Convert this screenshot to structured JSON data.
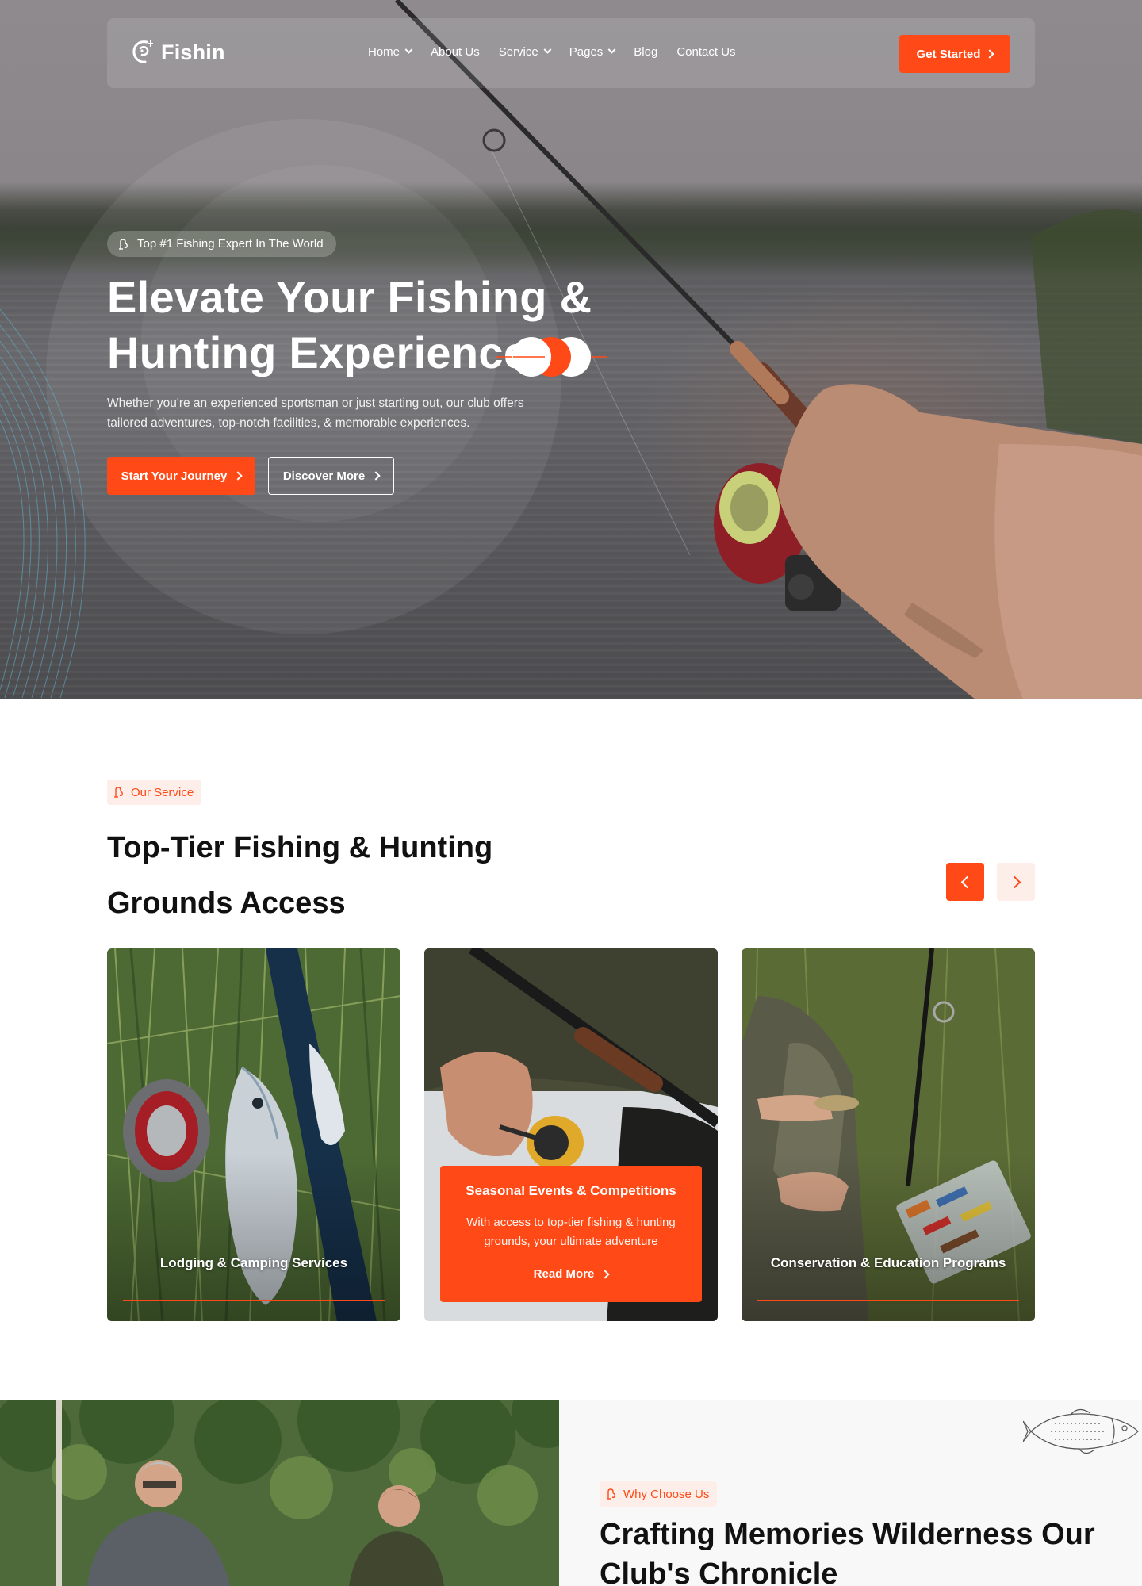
{
  "header": {
    "logo_text": "Fishin",
    "nav": [
      {
        "label": "Home",
        "has_dropdown": true
      },
      {
        "label": "About Us",
        "has_dropdown": false
      },
      {
        "label": "Service",
        "has_dropdown": true
      },
      {
        "label": "Pages",
        "has_dropdown": true
      },
      {
        "label": "Blog",
        "has_dropdown": false
      },
      {
        "label": "Contact Us",
        "has_dropdown": false
      }
    ],
    "cta_label": "Get Started"
  },
  "hero": {
    "badge": "Top #1 Fishing Expert In The World",
    "title_line1": "Elevate Your Fishing &",
    "title_line2": "Hunting Experience",
    "description": "Whether you're an experienced sportsman or just starting out, our club offers tailored adventures, top-notch facilities, & memorable experiences.",
    "primary_button": "Start Your Journey",
    "secondary_button": "Discover More"
  },
  "services": {
    "badge": "Our Service",
    "title_line1": "Top-Tier Fishing & Hunting",
    "title_line2": "Grounds Access",
    "cards": [
      {
        "title": "Lodging & Camping Services"
      },
      {
        "title": "Seasonal Events & Competitions",
        "description": "With access to top-tier fishing & hunting grounds, your ultimate adventure",
        "link": "Read More"
      },
      {
        "title": "Conservation & Education Programs"
      }
    ]
  },
  "why_choose": {
    "badge": "Why Choose Us",
    "title": "Crafting Memories Wilderness Our Club's Chronicle"
  },
  "colors": {
    "accent": "#ff4a17",
    "accent_soft": "#fdeee9",
    "heading": "#111111"
  }
}
